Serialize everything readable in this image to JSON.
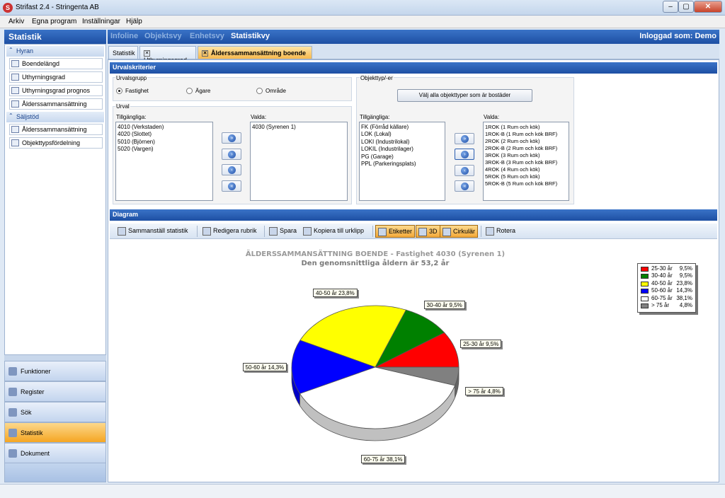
{
  "window": {
    "title": "Strifast 2.4 - Stringenta AB",
    "buttons": {
      "minimize": "–",
      "maximize": "▢",
      "close": "✕"
    }
  },
  "menu": [
    "Arkiv",
    "Egna program",
    "Inställningar",
    "Hjälp"
  ],
  "left": {
    "header": "Statistik",
    "groups": [
      {
        "label": "Hyran",
        "items": [
          "Boendelängd",
          "Uthyrningsgrad",
          "Uthyrningsgrad prognos",
          "Ålderssammansättning"
        ]
      },
      {
        "label": "Säljstöd",
        "items": [
          "Ålderssammansättning",
          "Objekttypsfördelning"
        ]
      }
    ],
    "nav": [
      "Funktioner",
      "Register",
      "Sök",
      "Statistik",
      "Dokument"
    ]
  },
  "top": {
    "tabs": [
      "Infoline",
      "Objektsvy",
      "Enhetsvy",
      "Statistikvy"
    ],
    "user": "Inloggad som: Demo"
  },
  "subtabs": [
    "Statistik",
    "Uthyrningsgrad",
    "Ålderssammansättning boende"
  ],
  "criteria": {
    "header": "Urvalskriterier",
    "group_label": "Urvalsgrupp",
    "radios": [
      "Fastighet",
      "Ägare",
      "Område"
    ],
    "selection_label": "Urval",
    "available_label": "Tillgängliga:",
    "selected_label": "Valda:",
    "available": [
      "4010 (Verkstaden)",
      "4020 (Slottet)",
      "5010 (Björnen)",
      "5020 (Vargen)"
    ],
    "selected": [
      "4030 (Syrenen 1)"
    ],
    "objtype_label": "Objekttyp/-er",
    "select_all_button": "Välj alla objekttyper som är bostäder",
    "obj_available": [
      "FK (Förråd källare)",
      "LOK (Lokal)",
      "LOKI (Industrilokal)",
      "LOKIL (Industrilager)",
      "PG (Garage)",
      "PPL (Parkeringsplats)"
    ],
    "obj_selected": [
      "1ROK (1 Rum och kök)",
      "1ROK-B (1 Rum och kök BRF)",
      "2ROK (2 Rum och kök)",
      "2ROK-B (2 Rum och kök BRF)",
      "3ROK (3 Rum och kök)",
      "3ROK-B (3 Rum och kök BRF)",
      "4ROK (4 Rum och kök)",
      "5ROK (5 Rum och kök)",
      "5ROK-B (5 Rum och kök BRF)"
    ]
  },
  "diagram": {
    "header": "Diagram",
    "toolbar": [
      "Sammanställ statistik",
      "Redigera rubrik",
      "Spara",
      "Kopiera till urklipp",
      "Etiketter",
      "3D",
      "Cirkulär",
      "Rotera"
    ]
  },
  "chart_data": {
    "type": "pie",
    "title": "ÄLDERSSAMMANSÄTTNING BOENDE - Fastighet 4030 (Syrenen 1)",
    "subtitle": "Den genomsnittliga åldern är 53,2 år",
    "legend_position": "top-right",
    "slices": [
      {
        "name": "25-30 år",
        "value": 9.5,
        "value_label": "9,5%",
        "label": "25-30 år 9,5%",
        "color": "#ff0000"
      },
      {
        "name": "30-40 år",
        "value": 9.5,
        "value_label": "9,5%",
        "label": "30-40 år 9,5%",
        "color": "#008000"
      },
      {
        "name": "40-50 år",
        "value": 23.8,
        "value_label": "23,8%",
        "label": "40-50 år 23,8%",
        "color": "#ffff00"
      },
      {
        "name": "50-60 år",
        "value": 14.3,
        "value_label": "14,3%",
        "label": "50-60 år 14,3%",
        "color": "#0000ff"
      },
      {
        "name": "60-75 år",
        "value": 38.1,
        "value_label": "38,1%",
        "label": "60-75 år 38,1%",
        "color": "#ffffff"
      },
      {
        "name": "> 75 år",
        "value": 4.8,
        "value_label": "4,8%",
        "label": "> 75 år 4,8%",
        "color": "#808080"
      }
    ]
  }
}
